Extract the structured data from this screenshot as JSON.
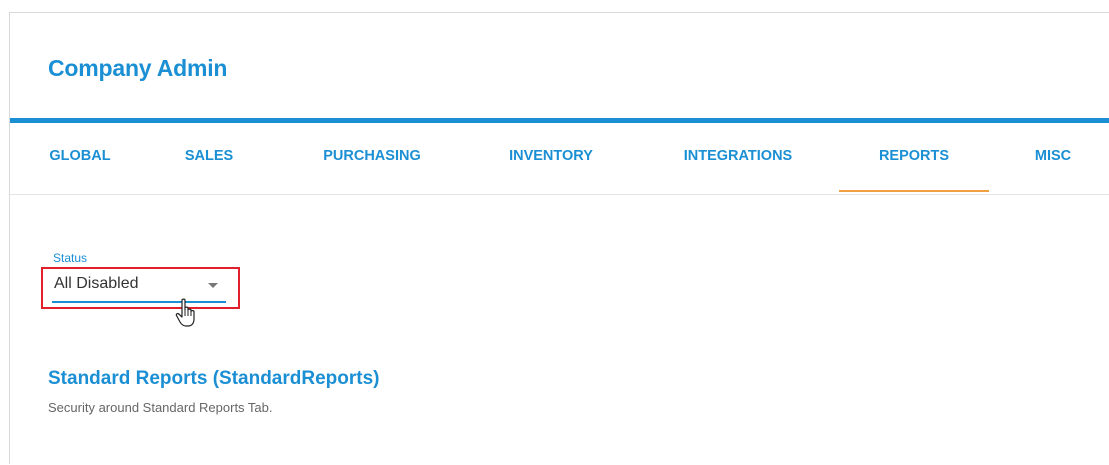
{
  "header": {
    "title": "Company Admin"
  },
  "tabs": [
    {
      "label": "GLOBAL",
      "active": false
    },
    {
      "label": "SALES",
      "active": false
    },
    {
      "label": "PURCHASING",
      "active": false
    },
    {
      "label": "INVENTORY",
      "active": false
    },
    {
      "label": "INTEGRATIONS",
      "active": false
    },
    {
      "label": "REPORTS",
      "active": true
    },
    {
      "label": "MISC",
      "active": false
    }
  ],
  "status_filter": {
    "label": "Status",
    "value": "All Disabled"
  },
  "section": {
    "title": "Standard Reports (StandardReports)",
    "description": "Security around Standard Reports Tab."
  },
  "colors": {
    "accent_blue": "#1b8fd4",
    "active_tab_underline": "#f0a040",
    "highlight_red": "#e0202a"
  },
  "icons": {
    "select_arrow": "chevron-down-icon",
    "cursor": "hand-pointer-icon"
  }
}
